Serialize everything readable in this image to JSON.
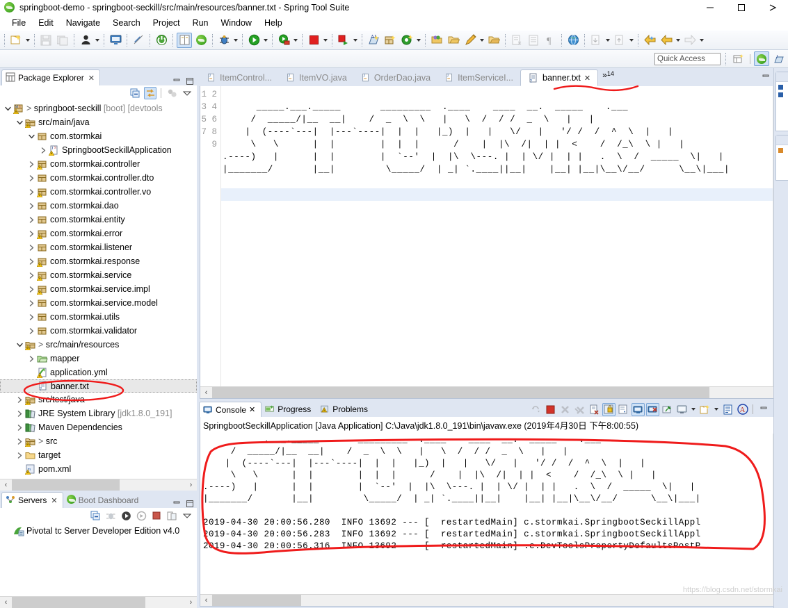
{
  "window": {
    "title": "springboot-demo - springboot-seckill/src/main/resources/banner.txt - Spring Tool Suite",
    "app_icon": "spring-leaf-icon",
    "minimize": "minimize-icon",
    "maximize": "maximize-icon",
    "close": "close-icon"
  },
  "menubar": {
    "items": [
      {
        "label": "File"
      },
      {
        "label": "Edit"
      },
      {
        "label": "Navigate"
      },
      {
        "label": "Search"
      },
      {
        "label": "Project"
      },
      {
        "label": "Run"
      },
      {
        "label": "Window"
      },
      {
        "label": "Help"
      }
    ]
  },
  "toolbar": {
    "groups": [
      {
        "items": [
          {
            "icon": "new-wizard-icon",
            "name": "new-button",
            "dropdown": true,
            "enabled": true
          }
        ]
      },
      {
        "items": [
          {
            "icon": "save-icon",
            "name": "save-button",
            "enabled": false
          },
          {
            "icon": "save-all-icon",
            "name": "save-all-button",
            "enabled": false
          }
        ]
      },
      {
        "items": [
          {
            "icon": "person-icon",
            "name": "open-task-button",
            "dropdown": true,
            "enabled": true
          }
        ]
      },
      {
        "items": [
          {
            "icon": "console-icon",
            "name": "open-console-button",
            "enabled": true
          }
        ]
      },
      {
        "items": [
          {
            "icon": "link-break-icon",
            "name": "unlink-button",
            "enabled": true
          }
        ]
      },
      {
        "items": [
          {
            "icon": "spring-boot-icon",
            "name": "boot-dashboard-button",
            "enabled": true
          }
        ]
      },
      {
        "items": [
          {
            "icon": "book-icon",
            "name": "open-type-button",
            "enabled": true,
            "active": true
          },
          {
            "icon": "spring-green-icon",
            "name": "spring-button",
            "enabled": true
          }
        ]
      },
      {
        "items": [
          {
            "icon": "debug-bug-icon",
            "name": "debug-button",
            "dropdown": true,
            "enabled": true
          }
        ]
      },
      {
        "items": [
          {
            "icon": "run-play-icon",
            "name": "run-button",
            "dropdown": true,
            "enabled": true
          }
        ]
      },
      {
        "items": [
          {
            "icon": "run-server-icon",
            "name": "run-on-server-button",
            "dropdown": true,
            "enabled": true
          }
        ]
      },
      {
        "items": [
          {
            "icon": "stop-square-icon",
            "name": "stop-button",
            "dropdown": true,
            "enabled": true
          }
        ]
      },
      {
        "items": [
          {
            "icon": "relaunch-icon",
            "name": "relaunch-button",
            "dropdown": true,
            "enabled": true
          }
        ]
      },
      {
        "items": [
          {
            "icon": "new-java-project-icon",
            "name": "new-java-project-button",
            "enabled": true
          },
          {
            "icon": "new-package-icon",
            "name": "new-package-button",
            "enabled": true
          },
          {
            "icon": "new-class-icon",
            "name": "new-class-button",
            "dropdown": true,
            "enabled": true
          }
        ]
      },
      {
        "items": [
          {
            "icon": "open-package-icon",
            "name": "open-package-button",
            "enabled": true
          },
          {
            "icon": "open-folder-icon",
            "name": "open-folder-button",
            "enabled": true
          },
          {
            "icon": "pencil-icon",
            "name": "edit-button",
            "dropdown": true,
            "enabled": true
          },
          {
            "icon": "open-resource-icon",
            "name": "open-resource-button",
            "enabled": true
          }
        ]
      },
      {
        "items": [
          {
            "icon": "externalize-strings-icon",
            "name": "externalize-strings-button",
            "enabled": false
          },
          {
            "icon": "list-icon",
            "name": "list-button",
            "enabled": false
          },
          {
            "icon": "pilcrow-icon",
            "name": "show-whitespace-button",
            "enabled": false
          }
        ]
      },
      {
        "items": [
          {
            "icon": "globe-icon",
            "name": "open-browser-button",
            "enabled": true
          }
        ]
      },
      {
        "items": [
          {
            "icon": "next-annotation-icon",
            "name": "next-annotation-button",
            "dropdown": true,
            "enabled": false
          },
          {
            "icon": "prev-annotation-icon",
            "name": "previous-annotation-button",
            "dropdown": true,
            "enabled": false
          }
        ]
      },
      {
        "items": [
          {
            "icon": "back-yellow-icon",
            "name": "back-button",
            "enabled": true
          },
          {
            "icon": "back-arrow-icon",
            "name": "backward-history-button",
            "dropdown": true,
            "enabled": true
          },
          {
            "icon": "forward-arrow-icon",
            "name": "forward-history-button",
            "dropdown": true,
            "enabled": false
          }
        ]
      }
    ]
  },
  "quick_access": {
    "placeholder": "Quick Access",
    "value": "",
    "open_perspective_icon": "open-perspective-icon",
    "perspectives": [
      {
        "icon": "spring-perspective-icon",
        "name": "perspective-spring",
        "selected": true
      },
      {
        "icon": "java-perspective-icon",
        "name": "perspective-java",
        "selected": false
      }
    ]
  },
  "package_explorer": {
    "tab_label": "Package Explorer",
    "close_glyph": "✕",
    "toolbar": [
      {
        "icon": "collapse-all-icon",
        "name": "collapse-all-button"
      },
      {
        "icon": "link-with-editor-icon",
        "name": "link-with-editor-button",
        "selected": true
      },
      {
        "icon": "focus-active-task-icon",
        "name": "focus-active-task-button"
      },
      {
        "icon": "view-menu-icon",
        "name": "view-menu-button"
      }
    ],
    "tree": [
      {
        "indent": 0,
        "twist": "expanded",
        "icon": "java-project-icon",
        "label": "springboot-seckill",
        "suffix": " [boot] [devtools",
        "prefix_gt": "> "
      },
      {
        "indent": 1,
        "twist": "expanded",
        "icon": "source-folder-warn-icon",
        "label": "src/main/java"
      },
      {
        "indent": 2,
        "twist": "expanded",
        "icon": "package-icon",
        "label": "com.stormkai"
      },
      {
        "indent": 3,
        "twist": "collapsed",
        "icon": "java-class-icon",
        "label": "SpringbootSeckillApplication"
      },
      {
        "indent": 2,
        "twist": "collapsed",
        "icon": "package-warn-icon",
        "label": "com.stormkai.controller"
      },
      {
        "indent": 2,
        "twist": "collapsed",
        "icon": "package-icon",
        "label": "com.stormkai.controller.dto"
      },
      {
        "indent": 2,
        "twist": "collapsed",
        "icon": "package-warn-icon",
        "label": "com.stormkai.controller.vo"
      },
      {
        "indent": 2,
        "twist": "collapsed",
        "icon": "package-icon",
        "label": "com.stormkai.dao"
      },
      {
        "indent": 2,
        "twist": "collapsed",
        "icon": "package-icon",
        "label": "com.stormkai.entity"
      },
      {
        "indent": 2,
        "twist": "collapsed",
        "icon": "package-warn-icon",
        "label": "com.stormkai.error"
      },
      {
        "indent": 2,
        "twist": "collapsed",
        "icon": "package-icon",
        "label": "com.stormkai.listener"
      },
      {
        "indent": 2,
        "twist": "collapsed",
        "icon": "package-warn-icon",
        "label": "com.stormkai.response"
      },
      {
        "indent": 2,
        "twist": "collapsed",
        "icon": "package-warn-icon",
        "label": "com.stormkai.service"
      },
      {
        "indent": 2,
        "twist": "collapsed",
        "icon": "package-warn-icon",
        "label": "com.stormkai.service.impl"
      },
      {
        "indent": 2,
        "twist": "collapsed",
        "icon": "package-icon",
        "label": "com.stormkai.service.model"
      },
      {
        "indent": 2,
        "twist": "collapsed",
        "icon": "package-icon",
        "label": "com.stormkai.utils"
      },
      {
        "indent": 2,
        "twist": "collapsed",
        "icon": "package-icon",
        "label": "com.stormkai.validator"
      },
      {
        "indent": 1,
        "twist": "expanded",
        "icon": "source-folder-warn-icon",
        "label": "src/main/resources",
        "prefix_gt": "> "
      },
      {
        "indent": 2,
        "twist": "collapsed",
        "icon": "folder-green-icon",
        "label": "mapper"
      },
      {
        "indent": 2,
        "twist": "none",
        "icon": "yml-file-icon",
        "label": "application.yml"
      },
      {
        "indent": 2,
        "twist": "none",
        "icon": "text-file-icon",
        "label": "banner.txt",
        "selected": true
      },
      {
        "indent": 1,
        "twist": "collapsed",
        "icon": "source-folder-warn-icon",
        "label": "src/test/java"
      },
      {
        "indent": 1,
        "twist": "collapsed",
        "icon": "library-icon",
        "label": "JRE System Library",
        "suffix": " [jdk1.8.0_191]"
      },
      {
        "indent": 1,
        "twist": "collapsed",
        "icon": "library-icon",
        "label": "Maven Dependencies"
      },
      {
        "indent": 1,
        "twist": "collapsed",
        "icon": "source-folder-warn-icon",
        "label": "src",
        "prefix_gt": "> "
      },
      {
        "indent": 1,
        "twist": "collapsed",
        "icon": "folder-icon",
        "label": "target"
      },
      {
        "indent": 1,
        "twist": "none",
        "icon": "pom-file-icon",
        "label": "pom.xml"
      }
    ]
  },
  "servers_view": {
    "tabs": [
      {
        "label": "Servers",
        "icon": "servers-icon",
        "selected": true,
        "close_glyph": "✕"
      },
      {
        "label": "Boot Dashboard",
        "icon": "boot-dashboard-icon",
        "selected": false
      }
    ],
    "toolbar": [
      {
        "icon": "collapse-all-icon",
        "name": "servers-collapse-all-button"
      },
      {
        "icon": "debug-icon",
        "name": "servers-debug-button"
      },
      {
        "icon": "start-icon",
        "name": "servers-start-button"
      },
      {
        "icon": "profile-icon",
        "name": "servers-profile-button"
      },
      {
        "icon": "stop-icon",
        "name": "servers-stop-button"
      },
      {
        "icon": "publish-icon",
        "name": "servers-publish-button"
      },
      {
        "icon": "view-menu-icon",
        "name": "servers-view-menu-button"
      }
    ],
    "items": [
      {
        "icon": "pivotal-server-icon",
        "label": "Pivotal tc Server Developer Edition v4.0"
      }
    ]
  },
  "editor": {
    "tabs": [
      {
        "label": "ItemControl...",
        "icon": "java-file-icon",
        "selected": false
      },
      {
        "label": "ItemVO.java",
        "icon": "java-file-icon",
        "selected": false
      },
      {
        "label": "OrderDao.java",
        "icon": "java-file-icon",
        "selected": false
      },
      {
        "label": "ItemServiceI...",
        "icon": "java-file-icon",
        "selected": false
      },
      {
        "label": "banner.txt",
        "icon": "text-file-icon",
        "selected": true,
        "close_glyph": "✕"
      }
    ],
    "overflow": {
      "chevron": "»",
      "count": "14"
    },
    "minimize_icon": "minimize-icon",
    "maximize_icon": "maximize-icon",
    "line_numbers": [
      "1",
      "2",
      "3",
      "4",
      "5",
      "6",
      "7",
      "8",
      "9"
    ],
    "current_line": 9,
    "content_lines": [
      "",
      "      _____.___._____       _________  .____    ____  __.  _____    .___",
      "     /  _____/|__  __|    /  _  \\  \\   |   \\  /  / /  _  \\   |   |",
      "    |  (----`---|  |---`----|  |  |   |_)  |   |   \\/   |   '/ /  /  ^  \\  |   |",
      "     \\   \\      |  |        |  |  |      /    |  |\\  /|  | |  <    /  /_\\  \\ |   |",
      ".----)   |      |  |        |  `--'  |  |\\  \\---. |  | \\/ |  | |   .  \\  /  _____  \\|   |",
      "|_______/       |__|         \\_____/  | _| `.____||__|    |__| |__|\\__\\/__/      \\__\\|___|",
      "",
      ""
    ]
  },
  "console": {
    "tabs": [
      {
        "label": "Console",
        "icon": "console-icon",
        "selected": true,
        "close_glyph": "✕"
      },
      {
        "label": "Progress",
        "icon": "progress-icon",
        "selected": false
      },
      {
        "label": "Problems",
        "icon": "problems-icon",
        "selected": false
      }
    ],
    "toolbar": [
      {
        "icon": "terminate-all-icon",
        "name": "console-terminate-all-button",
        "enabled": false
      },
      {
        "icon": "stop-red-icon",
        "name": "console-terminate-button",
        "enabled": true
      },
      {
        "icon": "remove-launch-icon",
        "name": "console-remove-launch-button",
        "enabled": false
      },
      {
        "icon": "remove-all-launches-icon",
        "name": "console-remove-all-button",
        "enabled": false
      },
      {
        "icon": "clear-console-icon",
        "name": "console-clear-button",
        "enabled": true
      },
      {
        "icon": "scroll-lock-icon",
        "name": "console-scroll-lock-button",
        "selected": true
      },
      {
        "icon": "word-wrap-icon",
        "name": "console-word-wrap-button",
        "enabled": true
      },
      {
        "icon": "show-console-on-output-icon",
        "name": "console-show-on-output-button",
        "selected": true
      },
      {
        "icon": "show-console-on-error-icon",
        "name": "console-show-on-error-button",
        "selected": true
      },
      {
        "icon": "pin-console-icon",
        "name": "console-pin-button",
        "enabled": true
      },
      {
        "icon": "display-console-icon",
        "name": "console-display-button",
        "dropdown": true,
        "enabled": true
      },
      {
        "icon": "open-console-new-icon",
        "name": "console-open-new-button",
        "dropdown": true,
        "enabled": true
      },
      {
        "icon": "view-menu-icon",
        "name": "console-view-menu-button",
        "enabled": true
      },
      {
        "icon": "ansi-icon",
        "name": "console-ansi-button",
        "enabled": true
      }
    ],
    "minimize_icon": "minimize-icon",
    "maximize_icon": "maximize-icon",
    "process_title": "SpringbootSeckillApplication [Java Application] C:\\Java\\jdk1.8.0_191\\bin\\javaw.exe (2019年4月30日 下午8:00:55)",
    "banner_lines": [
      "      _____.___._____       _________  .____    ____  __.  _____    .___",
      "     /  _____/|__  __|    /  _  \\  \\   |   \\  /  / /  _  \\   |   |",
      "    |  (----`---|  |---`----|  |  |   |_)  |   |   \\/   |   '/ /  /  ^  \\  |   |",
      "     \\   \\      |  |        |  |  |      /    |  |\\  /|  | |  <    /  /_\\  \\ |   |",
      ".----)   |      |  |        |  `--'  |  |\\  \\---. |  | \\/ |  | |   .  \\  /  _____  \\|   |",
      "|_______/       |__|         \\_____/  | _| `.____||__|    |__| |__|\\__\\/__/      \\__\\|___|"
    ],
    "log_lines": [
      "2019-04-30 20:00:56.280  INFO 13692 --- [  restartedMain] c.stormkai.SpringbootSeckillAppl",
      "2019-04-30 20:00:56.283  INFO 13692 --- [  restartedMain] c.stormkai.SpringbootSeckillAppl",
      "2019-04-30 20:00:56.316  INFO 13692 --- [  restartedMain] .e.DevToolsPropertyDefaultsPostP"
    ]
  },
  "watermark": "https://blog.csdn.net/stormkai",
  "colors": {
    "accent_blue": "#cfe2f7",
    "tab_bg": "#dfe6f2",
    "annotation_red": "#f01010",
    "current_line": "#e8f0fb",
    "border": "#b8c4d6"
  },
  "annotations": [
    {
      "name": "banner-tab-underline",
      "shape": "squiggle"
    },
    {
      "name": "banner-txt-tree-circle",
      "shape": "ellipse"
    },
    {
      "name": "console-banner-circle",
      "shape": "blob"
    }
  ]
}
